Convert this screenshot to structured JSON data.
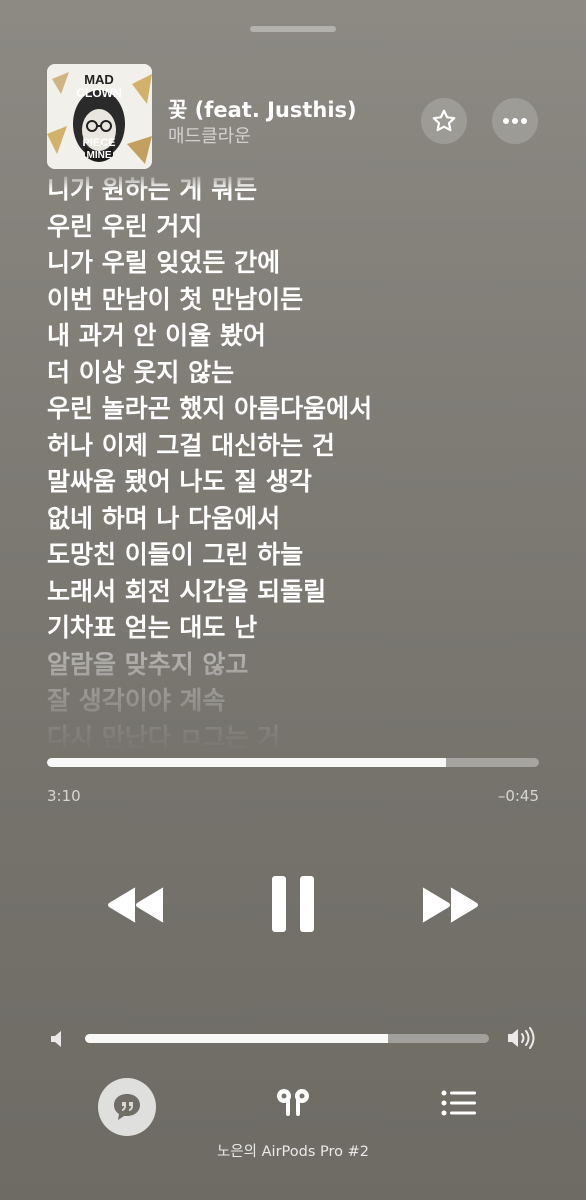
{
  "now_playing": {
    "title": "꽃 (feat. Justhis)",
    "artist": "매드클라운",
    "album_art": {
      "lettering": [
        "MAD",
        "CLOWN",
        "PIECE",
        "MINE"
      ],
      "accent_color": "#c9a24a"
    }
  },
  "actions": {
    "favorite_icon": "star-icon",
    "more_icon": "ellipsis-icon"
  },
  "lyrics": [
    {
      "text": "니가 원하는 게 뭐든",
      "dim": false
    },
    {
      "text": "우린 우린 거지",
      "dim": false
    },
    {
      "text": "니가 우릴 잊었든 간에",
      "dim": false
    },
    {
      "text": "이번 만남이 첫 만남이든",
      "dim": false
    },
    {
      "text": "내 과거 안 이율 봤어",
      "dim": false
    },
    {
      "text": "더 이상 웃지 않는",
      "dim": false
    },
    {
      "text": "우린 놀라곤 했지 아름다움에서",
      "dim": false
    },
    {
      "text": "허나 이제 그걸 대신하는 건",
      "dim": false
    },
    {
      "text": "말싸움 됐어 나도 질 생각",
      "dim": false
    },
    {
      "text": "없네 하며 나 다움에서",
      "dim": false
    },
    {
      "text": "도망친 이들이 그린 하늘",
      "dim": false
    },
    {
      "text": "노래서 회전 시간을 되돌릴",
      "dim": false
    },
    {
      "text": "기차표 얻는 대도 난",
      "dim": false
    },
    {
      "text": "알람을 맞추지 않고",
      "dim": true
    },
    {
      "text": "잘 생각이야 계속",
      "dim": true
    },
    {
      "text": "다시 만난다 ㅁ그는 거",
      "dim": true
    }
  ],
  "playback": {
    "elapsed": "3:10",
    "remaining": "–0:45",
    "progress_fraction": 0.81
  },
  "controls": {
    "rewind_icon": "rewind-icon",
    "pause_icon": "pause-icon",
    "forward_icon": "fast-forward-icon"
  },
  "volume": {
    "level_fraction": 0.75
  },
  "bottom_bar": {
    "lyrics_icon": "lyrics-quote-icon",
    "airplay_icon": "airpods-icon",
    "queue_icon": "queue-list-icon",
    "device_name": "노은의 AirPods Pro #2"
  },
  "colors": {
    "background": "#7e7c75",
    "foreground": "#ffffff"
  }
}
